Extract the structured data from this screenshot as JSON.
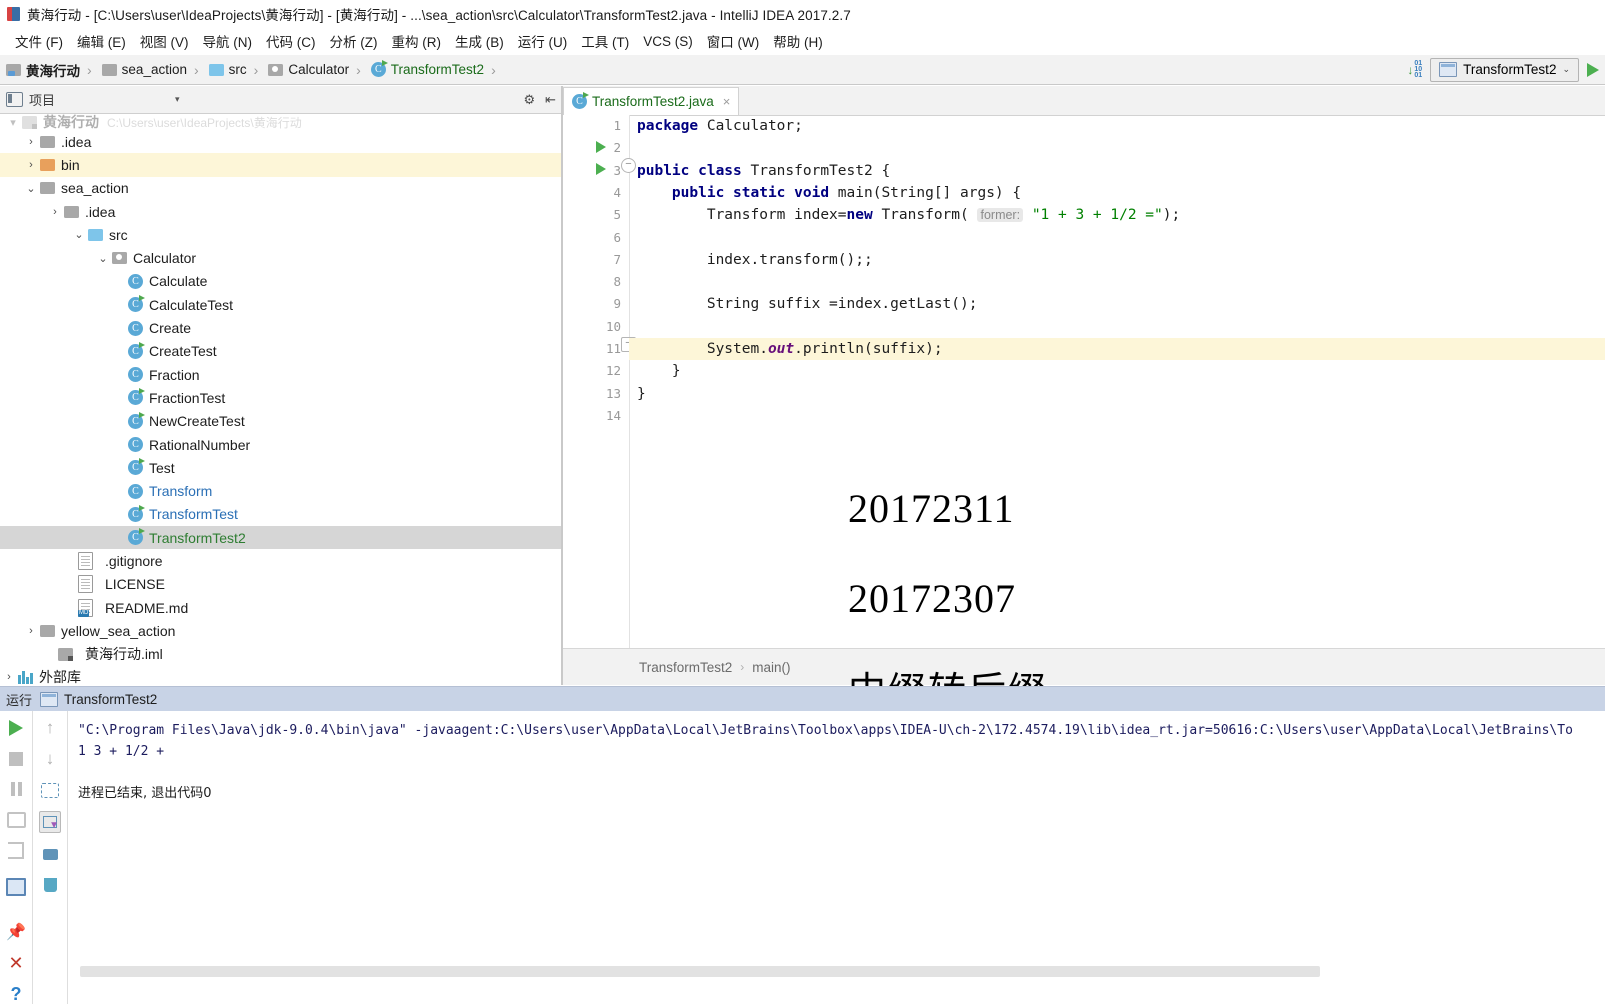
{
  "window": {
    "title": "黄海行动 - [C:\\Users\\user\\IdeaProjects\\黄海行动] - [黄海行动] - ...\\sea_action\\src\\Calculator\\TransformTest2.java - IntelliJ IDEA 2017.2.7",
    "app_icon": "intellij-icon"
  },
  "menu": {
    "items": [
      {
        "label": "文件 (F)"
      },
      {
        "label": "编辑 (E)"
      },
      {
        "label": "视图 (V)"
      },
      {
        "label": "导航 (N)"
      },
      {
        "label": "代码 (C)"
      },
      {
        "label": "分析 (Z)"
      },
      {
        "label": "重构 (R)"
      },
      {
        "label": "生成 (B)"
      },
      {
        "label": "运行 (U)"
      },
      {
        "label": "工具 (T)"
      },
      {
        "label": "VCS (S)"
      },
      {
        "label": "窗口 (W)"
      },
      {
        "label": "帮助 (H)"
      }
    ]
  },
  "navbar": {
    "crumbs": [
      {
        "label": "黄海行动",
        "icon": "module-folder-icon"
      },
      {
        "label": "sea_action",
        "icon": "folder-icon"
      },
      {
        "label": "src",
        "icon": "source-folder-icon"
      },
      {
        "label": "Calculator",
        "icon": "package-folder-icon"
      },
      {
        "label": "TransformTest2",
        "icon": "java-class-icon"
      }
    ],
    "separator": "›",
    "run_config": "TransformTest2",
    "run_config_chevron": "⌄",
    "update_icon": "update-project-icon"
  },
  "project_panel": {
    "title": "项目",
    "collapse_caret": "▾",
    "settings_icon": "gear-icon",
    "hide_icon": "collapse-icon",
    "tree": [
      {
        "label": "黄海行动",
        "detail": "C:\\Users\\user\\IdeaProjects\\黄海行动",
        "icon": "module-icon",
        "indent": 0,
        "arrow": "▾",
        "state": "ghost"
      },
      {
        "label": ".idea",
        "icon": "folder-icon",
        "indent": 1,
        "arrow": "›",
        "state": "normal"
      },
      {
        "label": "bin",
        "icon": "excluded-folder-icon",
        "indent": 1,
        "arrow": "›",
        "state": "highlight"
      },
      {
        "label": "sea_action",
        "icon": "folder-icon",
        "indent": 1,
        "arrow": "⌄",
        "state": "normal"
      },
      {
        "label": ".idea",
        "icon": "folder-icon",
        "indent": 2,
        "arrow": "›",
        "state": "normal"
      },
      {
        "label": "src",
        "icon": "source-folder-icon",
        "indent": 3,
        "arrow": "⌄",
        "state": "normal"
      },
      {
        "label": "Calculator",
        "icon": "package-folder-icon",
        "indent": 4,
        "arrow": "⌄",
        "state": "normal"
      },
      {
        "label": "Calculate",
        "icon": "java-class-icon",
        "indent": 6,
        "arrow": "",
        "state": "normal"
      },
      {
        "label": "CalculateTest",
        "icon": "java-class-runnable-icon",
        "indent": 6,
        "arrow": "",
        "state": "normal"
      },
      {
        "label": "Create",
        "icon": "java-class-icon",
        "indent": 6,
        "arrow": "",
        "state": "normal"
      },
      {
        "label": "CreateTest",
        "icon": "java-class-runnable-icon",
        "indent": 6,
        "arrow": "",
        "state": "normal"
      },
      {
        "label": "Fraction",
        "icon": "java-class-icon",
        "indent": 6,
        "arrow": "",
        "state": "normal"
      },
      {
        "label": "FractionTest",
        "icon": "java-class-runnable-icon",
        "indent": 6,
        "arrow": "",
        "state": "normal"
      },
      {
        "label": "NewCreateTest",
        "icon": "java-class-runnable-icon",
        "indent": 6,
        "arrow": "",
        "state": "normal"
      },
      {
        "label": "RationalNumber",
        "icon": "java-class-icon",
        "indent": 6,
        "arrow": "",
        "state": "normal"
      },
      {
        "label": "Test",
        "icon": "java-class-runnable-icon",
        "indent": 6,
        "arrow": "",
        "state": "normal"
      },
      {
        "label": "Transform",
        "icon": "java-class-icon",
        "indent": 6,
        "arrow": "",
        "state": "cut"
      },
      {
        "label": "TransformTest",
        "icon": "java-class-runnable-icon",
        "indent": 6,
        "arrow": "",
        "state": "cut"
      },
      {
        "label": "TransformTest2",
        "icon": "java-class-runnable-icon",
        "indent": 6,
        "arrow": "",
        "state": "selected"
      },
      {
        "label": ".gitignore",
        "icon": "file-icon",
        "indent": 3,
        "arrow": "",
        "state": "normal"
      },
      {
        "label": "LICENSE",
        "icon": "file-icon",
        "indent": 3,
        "arrow": "",
        "state": "normal"
      },
      {
        "label": "README.md",
        "icon": "markdown-file-icon",
        "indent": 3,
        "arrow": "",
        "state": "normal"
      },
      {
        "label": "yellow_sea_action",
        "icon": "folder-icon",
        "indent": 1,
        "arrow": "›",
        "state": "normal"
      },
      {
        "label": "黄海行动.iml",
        "icon": "iml-file-icon",
        "indent": 1,
        "arrow": "",
        "state": "normal"
      },
      {
        "label": "外部库",
        "icon": "library-icon",
        "indent": 0,
        "arrow": "›",
        "state": "normal"
      }
    ]
  },
  "editor": {
    "tab": {
      "label": "TransformTest2.java",
      "icon": "java-class-runnable-icon",
      "close": "×"
    },
    "lines": [
      {
        "n": "1",
        "gutter": "",
        "fold": "",
        "text": "package Calculator;"
      },
      {
        "n": "2",
        "gutter": "",
        "fold": "",
        "text": ""
      },
      {
        "n": "3",
        "gutter": "run",
        "fold": "",
        "text": "public class TransformTest2 {"
      },
      {
        "n": "4",
        "gutter": "run",
        "fold": "end",
        "text": "    public static void main(String[] args) {"
      },
      {
        "n": "5",
        "gutter": "",
        "fold": "",
        "text": "        Transform index=new Transform( former: \"1 + 3 + 1/2 =\");"
      },
      {
        "n": "6",
        "gutter": "",
        "fold": "",
        "text": ""
      },
      {
        "n": "7",
        "gutter": "",
        "fold": "",
        "text": "        index.transform();;"
      },
      {
        "n": "8",
        "gutter": "",
        "fold": "",
        "text": ""
      },
      {
        "n": "9",
        "gutter": "",
        "fold": "",
        "text": "        String suffix =index.getLast();"
      },
      {
        "n": "10",
        "gutter": "",
        "fold": "",
        "text": ""
      },
      {
        "n": "11",
        "gutter": "",
        "fold": "",
        "text": "        System.out.println(suffix);",
        "highlight": true
      },
      {
        "n": "12",
        "gutter": "",
        "fold": "sq",
        "text": "    }"
      },
      {
        "n": "13",
        "gutter": "",
        "fold": "",
        "text": "}"
      },
      {
        "n": "14",
        "gutter": "",
        "fold": "",
        "text": ""
      }
    ],
    "param_hint": "former:",
    "breadcrumb": [
      "TransformTest2",
      "main()"
    ],
    "breadcrumb_separator": "›"
  },
  "annotations": {
    "student_id_1": "20172311",
    "student_id_2": "20172307",
    "caption": "中缀转后缀"
  },
  "run_panel": {
    "label": "运行",
    "config_name": "TransformTest2",
    "config_icon": "window-icon",
    "toolbar_left": [
      {
        "icon": "rerun-icon",
        "name": "rerun-button"
      },
      {
        "icon": "stop-icon",
        "name": "stop-button"
      },
      {
        "icon": "pause-icon",
        "name": "pause-button"
      },
      {
        "icon": "camera-icon",
        "name": "dump-threads-button"
      },
      {
        "icon": "exit-icon",
        "name": "resume-button"
      },
      {
        "icon": "console-icon",
        "name": "console-view-button"
      },
      {
        "icon": "pin-icon",
        "name": "pin-tab-button"
      },
      {
        "icon": "close-icon",
        "name": "close-button"
      },
      {
        "icon": "help-icon",
        "name": "help-button"
      }
    ],
    "toolbar_right": [
      {
        "icon": "arrow-up-icon",
        "name": "prev-occurrence-button"
      },
      {
        "icon": "arrow-down-icon",
        "name": "next-occurrence-button"
      },
      {
        "icon": "soft-wrap-icon",
        "name": "soft-wrap-button"
      },
      {
        "icon": "scroll-to-end-icon",
        "name": "scroll-to-end-button"
      },
      {
        "icon": "printer-icon",
        "name": "print-button"
      },
      {
        "icon": "trash-icon",
        "name": "clear-all-button"
      }
    ],
    "console": [
      "\"C:\\Program Files\\Java\\jdk-9.0.4\\bin\\java\" -javaagent:C:\\Users\\user\\AppData\\Local\\JetBrains\\Toolbox\\apps\\IDEA-U\\ch-2\\172.4574.19\\lib\\idea_rt.jar=50616:C:\\Users\\user\\AppData\\Local\\JetBrains\\To",
      "1 3 + 1/2 +",
      "",
      "进程已结束, 退出代码0"
    ]
  },
  "colors": {
    "accent_green": "#4caf50",
    "selection_grey": "#d6d6d6",
    "highlight_yellow": "#fdf6d8",
    "run_header_blue": "#c8d3e6",
    "link_blue": "#2a6fb5"
  }
}
